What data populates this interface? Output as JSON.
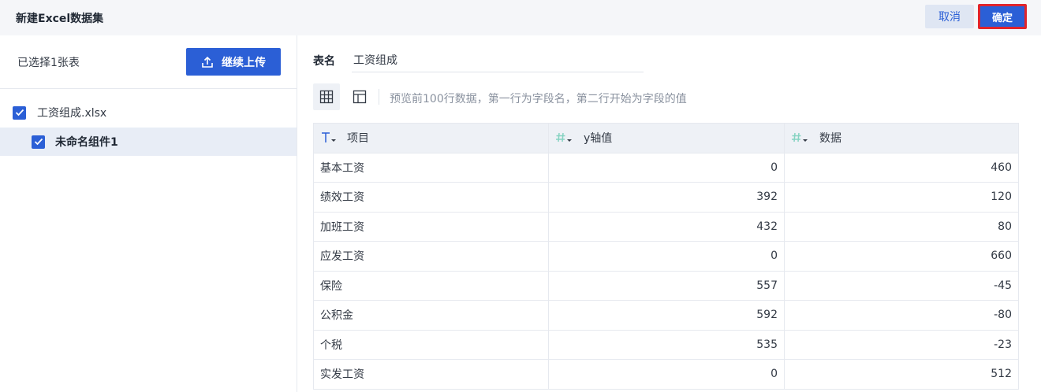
{
  "dialog": {
    "title": "新建Excel数据集",
    "cancel_label": "取消",
    "ok_label": "确定"
  },
  "left_panel": {
    "selected_count": "已选择1张表",
    "upload_label": "继续上传",
    "file_name": "工资组成.xlsx",
    "sheet_name": "未命名组件1"
  },
  "right_panel": {
    "table_name_label": "表名",
    "table_name_value": "工资组成",
    "preview_hint": "预览前100行数据，第一行为字段名，第二行开始为字段的值"
  },
  "table": {
    "columns": [
      {
        "name": "项目",
        "type_icon": "text-type-icon"
      },
      {
        "name": "y轴值",
        "type_icon": "number-type-icon"
      },
      {
        "name": "数据",
        "type_icon": "number-type-icon"
      }
    ],
    "rows": [
      [
        "基本工资",
        "0",
        "460"
      ],
      [
        "绩效工资",
        "392",
        "120"
      ],
      [
        "加班工资",
        "432",
        "80"
      ],
      [
        "应发工资",
        "0",
        "660"
      ],
      [
        "保险",
        "557",
        "-45"
      ],
      [
        "公积金",
        "592",
        "-80"
      ],
      [
        "个税",
        "535",
        "-23"
      ],
      [
        "实发工资",
        "0",
        "512"
      ]
    ]
  },
  "colors": {
    "primary": "#2b5fd6",
    "highlight_border": "#e0242c",
    "header_bg": "#f5f6f9",
    "selected_row_bg": "#e8edf6"
  }
}
